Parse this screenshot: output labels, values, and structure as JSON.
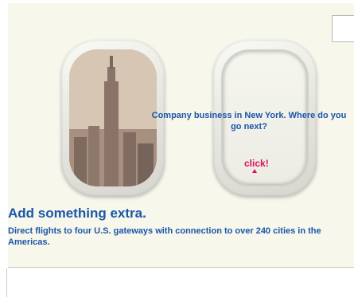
{
  "ad": {
    "headline": "Company business in New York. Where do you go next?",
    "cta": "click!",
    "tagline": "Add something extra.",
    "body": "Direct flights to four U.S. gateways with connection to over 240 cities in the Americas.",
    "colors": {
      "brand_blue": "#1b56a8",
      "cta_pink": "#d4145a",
      "background": "#f7f7ec"
    }
  }
}
